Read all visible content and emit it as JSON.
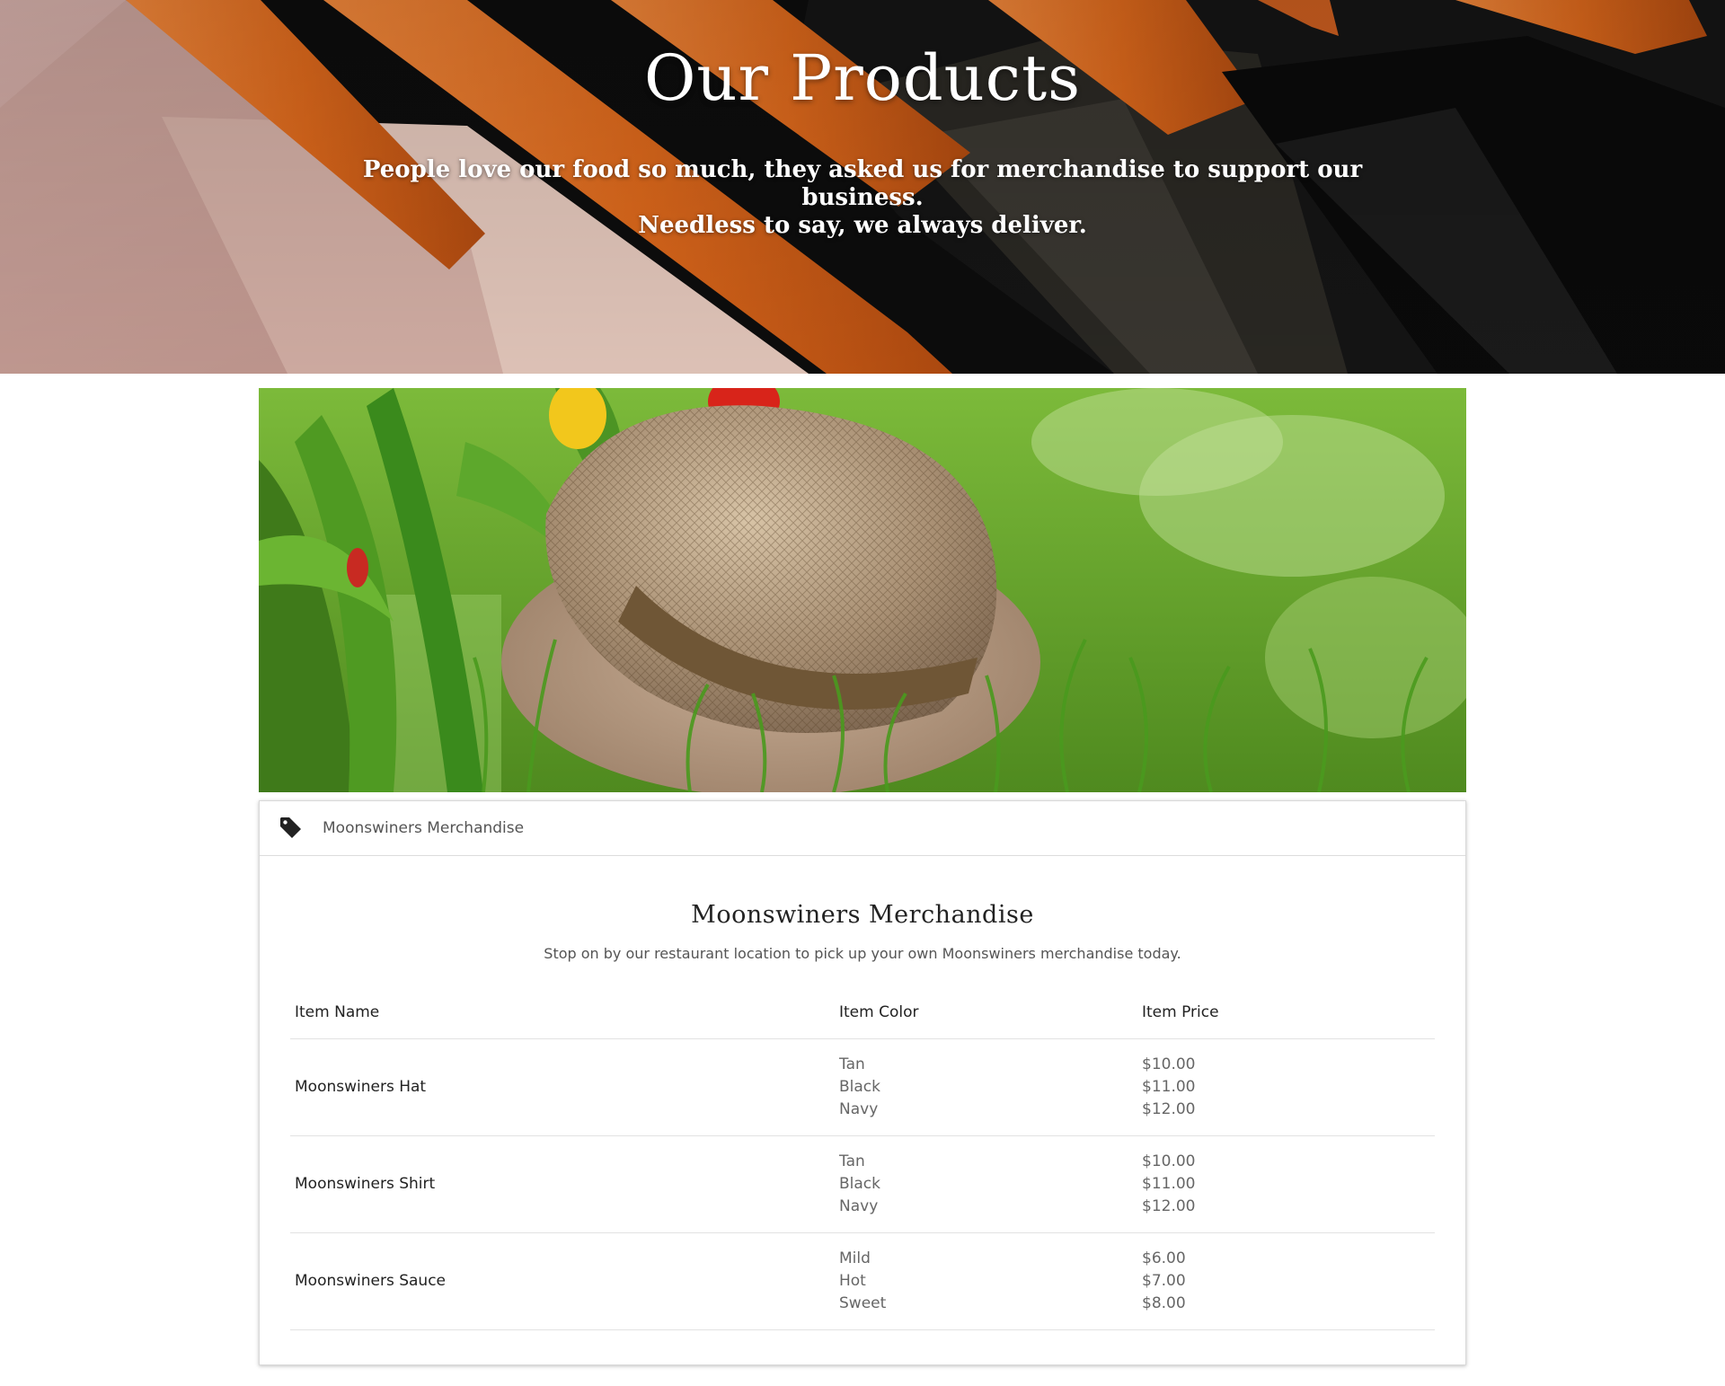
{
  "hero": {
    "title": "Our Products",
    "subtitle_line1": "People love our food so much, they asked us for merchandise to support our business.",
    "subtitle_line2": "Needless to say, we always deliver."
  },
  "card": {
    "tab_icon": "tag-icon",
    "tab_label": "Moonswiners Merchandise",
    "title": "Moonswiners Merchandise",
    "description": "Stop on by our restaurant location to pick up your own Moonswiners merchandise today.",
    "headers": [
      "Item Name",
      "Item Color",
      "Item Price"
    ],
    "items": [
      {
        "name": "Moonswiners Hat",
        "options": [
          {
            "color": "Tan",
            "price": "$10.00"
          },
          {
            "color": "Black",
            "price": "$11.00"
          },
          {
            "color": "Navy",
            "price": "$12.00"
          }
        ]
      },
      {
        "name": "Moonswiners Shirt",
        "options": [
          {
            "color": "Tan",
            "price": "$10.00"
          },
          {
            "color": "Black",
            "price": "$11.00"
          },
          {
            "color": "Navy",
            "price": "$12.00"
          }
        ]
      },
      {
        "name": "Moonswiners Sauce",
        "options": [
          {
            "color": "Mild",
            "price": "$6.00"
          },
          {
            "color": "Hot",
            "price": "$7.00"
          },
          {
            "color": "Sweet",
            "price": "$8.00"
          }
        ]
      }
    ]
  }
}
